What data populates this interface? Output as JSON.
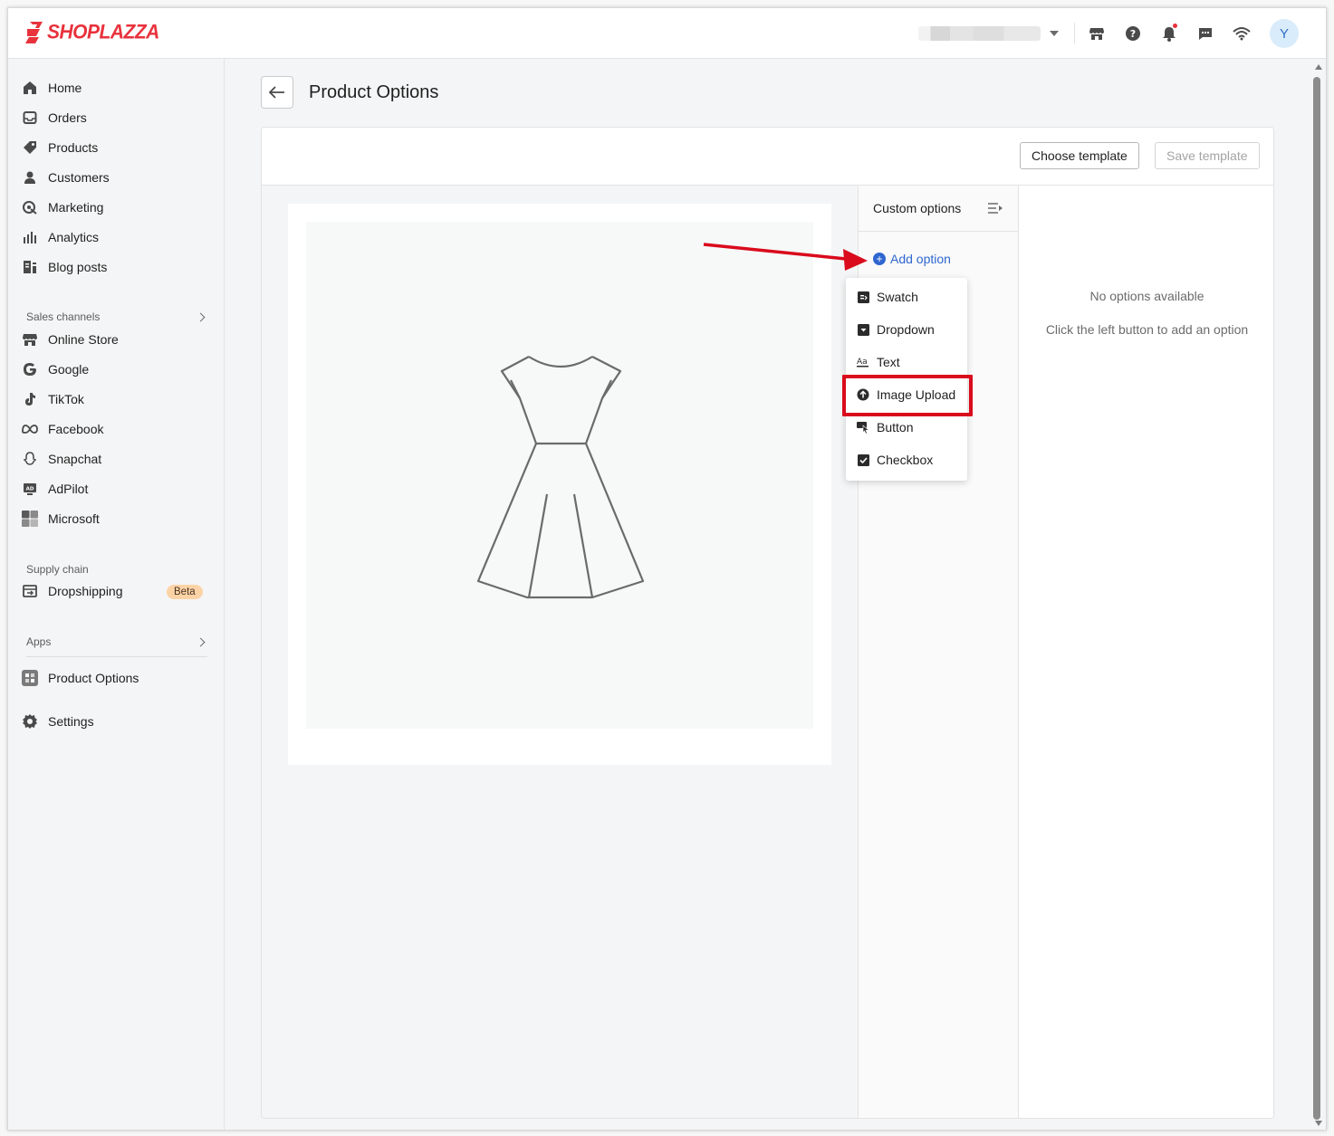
{
  "brand": {
    "name": "SHOPLAZZA",
    "color": "#e8323c"
  },
  "topbar": {
    "store_selector": {
      "value": "",
      "icon": "chevron-down-icon"
    },
    "icons": [
      "storefront-icon",
      "help-icon",
      "notification-bell-icon",
      "message-icon",
      "wifi-icon"
    ],
    "avatar_initial": "Y"
  },
  "sidebar": {
    "main_items": [
      {
        "label": "Home",
        "icon": "home-icon"
      },
      {
        "label": "Orders",
        "icon": "orders-icon"
      },
      {
        "label": "Products",
        "icon": "tag-icon"
      },
      {
        "label": "Customers",
        "icon": "person-icon"
      },
      {
        "label": "Marketing",
        "icon": "marketing-icon"
      },
      {
        "label": "Analytics",
        "icon": "bar-chart-icon"
      },
      {
        "label": "Blog posts",
        "icon": "blog-icon"
      }
    ],
    "sales_channels_title": "Sales channels",
    "sales_channels": [
      {
        "label": "Online Store",
        "icon": "store-icon"
      },
      {
        "label": "Google",
        "icon": "google-icon"
      },
      {
        "label": "TikTok",
        "icon": "tiktok-icon"
      },
      {
        "label": "Facebook",
        "icon": "meta-icon"
      },
      {
        "label": "Snapchat",
        "icon": "snapchat-icon"
      },
      {
        "label": "AdPilot",
        "icon": "adpilot-icon"
      },
      {
        "label": "Microsoft",
        "icon": "microsoft-icon"
      }
    ],
    "supply_chain_title": "Supply chain",
    "supply_chain": [
      {
        "label": "Dropshipping",
        "icon": "dropshipping-icon",
        "badge": "Beta"
      }
    ],
    "apps_title": "Apps",
    "apps": [
      {
        "label": "Product Options",
        "icon": "app-grid-icon"
      }
    ],
    "settings": {
      "label": "Settings",
      "icon": "gear-icon"
    }
  },
  "page": {
    "title": "Product Options",
    "back_icon": "arrow-left-icon"
  },
  "toolbar": {
    "choose_template": "Choose template",
    "save_template": "Save template"
  },
  "options_panel": {
    "title": "Custom options",
    "add_option": "Add option",
    "menu": [
      {
        "label": "Swatch",
        "icon": "swatch-icon"
      },
      {
        "label": "Dropdown",
        "icon": "dropdown-icon"
      },
      {
        "label": "Text",
        "icon": "text-icon"
      },
      {
        "label": "Image Upload",
        "icon": "upload-icon",
        "highlighted": true
      },
      {
        "label": "Button",
        "icon": "button-icon"
      },
      {
        "label": "Checkbox",
        "icon": "checkbox-icon"
      }
    ]
  },
  "empty_state": {
    "title": "No options available",
    "subtitle": "Click the left button to add an option"
  },
  "annotation": {
    "color": "#d90b1c"
  }
}
